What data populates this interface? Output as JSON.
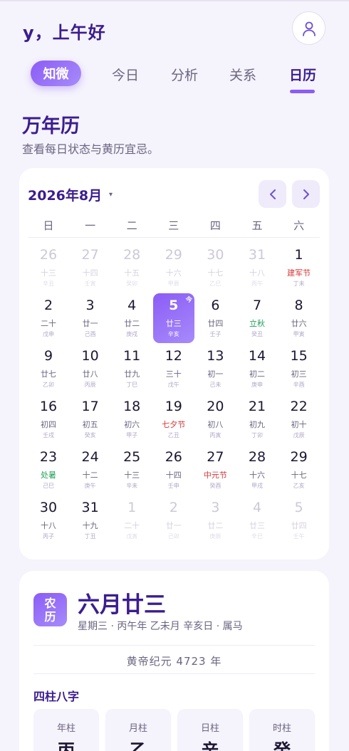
{
  "header": {
    "greeting": "y，上午好",
    "avatar_icon": "user-icon"
  },
  "tabs": [
    {
      "label": "知微"
    },
    {
      "label": "今日"
    },
    {
      "label": "分析"
    },
    {
      "label": "关系"
    },
    {
      "label": "日历",
      "active": true
    }
  ],
  "page": {
    "title": "万年历",
    "subtitle": "查看每日状态与黄历宜忌。"
  },
  "calendar": {
    "month_label": "2026年8月",
    "caret": "▾",
    "weekdays": [
      "日",
      "一",
      "二",
      "三",
      "四",
      "五",
      "六"
    ],
    "today_badge": "今",
    "days": [
      {
        "d": "26",
        "l": "十三",
        "g": "辛丑",
        "other": true
      },
      {
        "d": "27",
        "l": "十四",
        "g": "壬寅",
        "other": true
      },
      {
        "d": "28",
        "l": "十五",
        "g": "癸卯",
        "other": true
      },
      {
        "d": "29",
        "l": "十六",
        "g": "甲辰",
        "other": true
      },
      {
        "d": "30",
        "l": "十七",
        "g": "乙巳",
        "other": true
      },
      {
        "d": "31",
        "l": "十八",
        "g": "丙午",
        "other": true
      },
      {
        "d": "1",
        "l": "建军节",
        "g": "丁未",
        "kind": "fest"
      },
      {
        "d": "2",
        "l": "二十",
        "g": "戊申"
      },
      {
        "d": "3",
        "l": "廿一",
        "g": "己酉"
      },
      {
        "d": "4",
        "l": "廿二",
        "g": "庚戌"
      },
      {
        "d": "5",
        "l": "廿三",
        "g": "辛亥",
        "today": true
      },
      {
        "d": "6",
        "l": "廿四",
        "g": "壬子"
      },
      {
        "d": "7",
        "l": "立秋",
        "g": "癸丑",
        "kind": "term"
      },
      {
        "d": "8",
        "l": "廿六",
        "g": "甲寅"
      },
      {
        "d": "9",
        "l": "廿七",
        "g": "乙卯"
      },
      {
        "d": "10",
        "l": "廿八",
        "g": "丙辰"
      },
      {
        "d": "11",
        "l": "廿九",
        "g": "丁巳"
      },
      {
        "d": "12",
        "l": "三十",
        "g": "戊午"
      },
      {
        "d": "13",
        "l": "初一",
        "g": "己未"
      },
      {
        "d": "14",
        "l": "初二",
        "g": "庚申"
      },
      {
        "d": "15",
        "l": "初三",
        "g": "辛酉"
      },
      {
        "d": "16",
        "l": "初四",
        "g": "壬戌"
      },
      {
        "d": "17",
        "l": "初五",
        "g": "癸亥"
      },
      {
        "d": "18",
        "l": "初六",
        "g": "甲子"
      },
      {
        "d": "19",
        "l": "七夕节",
        "g": "乙丑",
        "kind": "fest"
      },
      {
        "d": "20",
        "l": "初八",
        "g": "丙寅"
      },
      {
        "d": "21",
        "l": "初九",
        "g": "丁卯"
      },
      {
        "d": "22",
        "l": "初十",
        "g": "戊辰"
      },
      {
        "d": "23",
        "l": "处暑",
        "g": "己巳",
        "kind": "term"
      },
      {
        "d": "24",
        "l": "十二",
        "g": "庚午"
      },
      {
        "d": "25",
        "l": "十三",
        "g": "辛未"
      },
      {
        "d": "26",
        "l": "十四",
        "g": "壬申"
      },
      {
        "d": "27",
        "l": "中元节",
        "g": "癸酉",
        "kind": "fest"
      },
      {
        "d": "28",
        "l": "十六",
        "g": "甲戌"
      },
      {
        "d": "29",
        "l": "十七",
        "g": "乙亥"
      },
      {
        "d": "30",
        "l": "十八",
        "g": "丙子"
      },
      {
        "d": "31",
        "l": "十九",
        "g": "丁丑"
      },
      {
        "d": "1",
        "l": "二十",
        "g": "戊寅",
        "other": true
      },
      {
        "d": "2",
        "l": "廿一",
        "g": "己卯",
        "other": true
      },
      {
        "d": "3",
        "l": "廿二",
        "g": "庚辰",
        "other": true
      },
      {
        "d": "4",
        "l": "廿三",
        "g": "辛巳",
        "other": true
      },
      {
        "d": "5",
        "l": "廿四",
        "g": "壬午",
        "other": true
      }
    ]
  },
  "detail": {
    "badge": [
      "农",
      "历"
    ],
    "lunar_date": "六月廿三",
    "info": "星期三 · 丙午年 乙未月 辛亥日 · 属马",
    "era": "黄帝纪元 4723 年",
    "bazi_title": "四柱八字",
    "pillars": [
      {
        "label": "年柱",
        "stem": "丙"
      },
      {
        "label": "月柱",
        "stem": "乙"
      },
      {
        "label": "日柱",
        "stem": "辛"
      },
      {
        "label": "时柱",
        "stem": "癸"
      }
    ]
  },
  "colors": {
    "accent": "#8b5cf6",
    "title": "#3b1d8f",
    "festival": "#d63636",
    "solar_term": "#22a05a"
  }
}
